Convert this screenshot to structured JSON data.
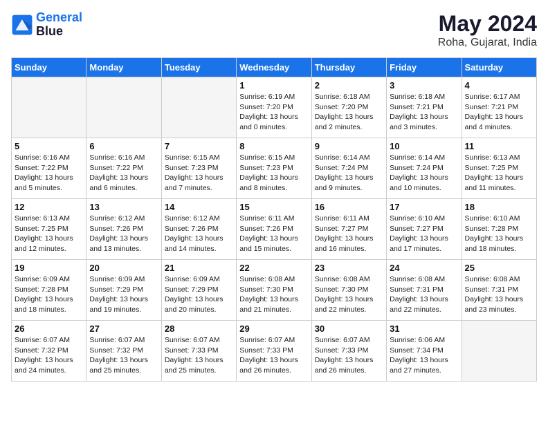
{
  "logo": {
    "line1": "General",
    "line2": "Blue"
  },
  "title": "May 2024",
  "location": "Roha, Gujarat, India",
  "weekdays": [
    "Sunday",
    "Monday",
    "Tuesday",
    "Wednesday",
    "Thursday",
    "Friday",
    "Saturday"
  ],
  "weeks": [
    [
      {
        "day": "",
        "info": ""
      },
      {
        "day": "",
        "info": ""
      },
      {
        "day": "",
        "info": ""
      },
      {
        "day": "1",
        "info": "Sunrise: 6:19 AM\nSunset: 7:20 PM\nDaylight: 13 hours\nand 0 minutes."
      },
      {
        "day": "2",
        "info": "Sunrise: 6:18 AM\nSunset: 7:20 PM\nDaylight: 13 hours\nand 2 minutes."
      },
      {
        "day": "3",
        "info": "Sunrise: 6:18 AM\nSunset: 7:21 PM\nDaylight: 13 hours\nand 3 minutes."
      },
      {
        "day": "4",
        "info": "Sunrise: 6:17 AM\nSunset: 7:21 PM\nDaylight: 13 hours\nand 4 minutes."
      }
    ],
    [
      {
        "day": "5",
        "info": "Sunrise: 6:16 AM\nSunset: 7:22 PM\nDaylight: 13 hours\nand 5 minutes."
      },
      {
        "day": "6",
        "info": "Sunrise: 6:16 AM\nSunset: 7:22 PM\nDaylight: 13 hours\nand 6 minutes."
      },
      {
        "day": "7",
        "info": "Sunrise: 6:15 AM\nSunset: 7:23 PM\nDaylight: 13 hours\nand 7 minutes."
      },
      {
        "day": "8",
        "info": "Sunrise: 6:15 AM\nSunset: 7:23 PM\nDaylight: 13 hours\nand 8 minutes."
      },
      {
        "day": "9",
        "info": "Sunrise: 6:14 AM\nSunset: 7:24 PM\nDaylight: 13 hours\nand 9 minutes."
      },
      {
        "day": "10",
        "info": "Sunrise: 6:14 AM\nSunset: 7:24 PM\nDaylight: 13 hours\nand 10 minutes."
      },
      {
        "day": "11",
        "info": "Sunrise: 6:13 AM\nSunset: 7:25 PM\nDaylight: 13 hours\nand 11 minutes."
      }
    ],
    [
      {
        "day": "12",
        "info": "Sunrise: 6:13 AM\nSunset: 7:25 PM\nDaylight: 13 hours\nand 12 minutes."
      },
      {
        "day": "13",
        "info": "Sunrise: 6:12 AM\nSunset: 7:26 PM\nDaylight: 13 hours\nand 13 minutes."
      },
      {
        "day": "14",
        "info": "Sunrise: 6:12 AM\nSunset: 7:26 PM\nDaylight: 13 hours\nand 14 minutes."
      },
      {
        "day": "15",
        "info": "Sunrise: 6:11 AM\nSunset: 7:26 PM\nDaylight: 13 hours\nand 15 minutes."
      },
      {
        "day": "16",
        "info": "Sunrise: 6:11 AM\nSunset: 7:27 PM\nDaylight: 13 hours\nand 16 minutes."
      },
      {
        "day": "17",
        "info": "Sunrise: 6:10 AM\nSunset: 7:27 PM\nDaylight: 13 hours\nand 17 minutes."
      },
      {
        "day": "18",
        "info": "Sunrise: 6:10 AM\nSunset: 7:28 PM\nDaylight: 13 hours\nand 18 minutes."
      }
    ],
    [
      {
        "day": "19",
        "info": "Sunrise: 6:09 AM\nSunset: 7:28 PM\nDaylight: 13 hours\nand 18 minutes."
      },
      {
        "day": "20",
        "info": "Sunrise: 6:09 AM\nSunset: 7:29 PM\nDaylight: 13 hours\nand 19 minutes."
      },
      {
        "day": "21",
        "info": "Sunrise: 6:09 AM\nSunset: 7:29 PM\nDaylight: 13 hours\nand 20 minutes."
      },
      {
        "day": "22",
        "info": "Sunrise: 6:08 AM\nSunset: 7:30 PM\nDaylight: 13 hours\nand 21 minutes."
      },
      {
        "day": "23",
        "info": "Sunrise: 6:08 AM\nSunset: 7:30 PM\nDaylight: 13 hours\nand 22 minutes."
      },
      {
        "day": "24",
        "info": "Sunrise: 6:08 AM\nSunset: 7:31 PM\nDaylight: 13 hours\nand 22 minutes."
      },
      {
        "day": "25",
        "info": "Sunrise: 6:08 AM\nSunset: 7:31 PM\nDaylight: 13 hours\nand 23 minutes."
      }
    ],
    [
      {
        "day": "26",
        "info": "Sunrise: 6:07 AM\nSunset: 7:32 PM\nDaylight: 13 hours\nand 24 minutes."
      },
      {
        "day": "27",
        "info": "Sunrise: 6:07 AM\nSunset: 7:32 PM\nDaylight: 13 hours\nand 25 minutes."
      },
      {
        "day": "28",
        "info": "Sunrise: 6:07 AM\nSunset: 7:33 PM\nDaylight: 13 hours\nand 25 minutes."
      },
      {
        "day": "29",
        "info": "Sunrise: 6:07 AM\nSunset: 7:33 PM\nDaylight: 13 hours\nand 26 minutes."
      },
      {
        "day": "30",
        "info": "Sunrise: 6:07 AM\nSunset: 7:33 PM\nDaylight: 13 hours\nand 26 minutes."
      },
      {
        "day": "31",
        "info": "Sunrise: 6:06 AM\nSunset: 7:34 PM\nDaylight: 13 hours\nand 27 minutes."
      },
      {
        "day": "",
        "info": ""
      }
    ]
  ]
}
